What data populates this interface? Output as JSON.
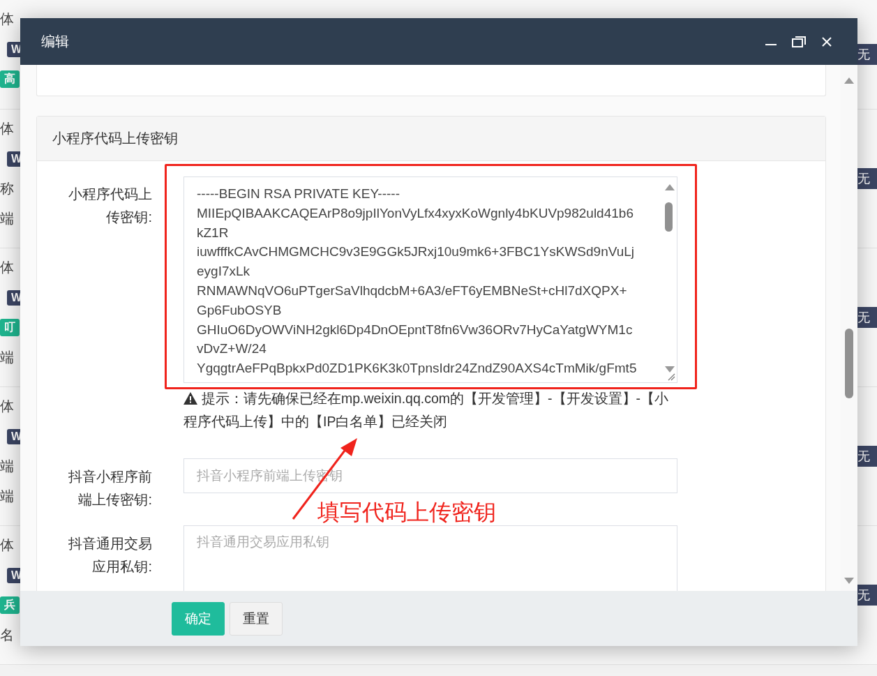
{
  "background_rows": [
    {
      "items": [
        {
          "kind": "text",
          "text": "体"
        },
        {
          "kind": "badge",
          "text": "W",
          "color": "#3b4563"
        },
        {
          "kind": "badge",
          "text": "高",
          "color": "#1fb58f"
        }
      ],
      "tag": "无"
    },
    {
      "items": [
        {
          "kind": "text",
          "text": "体"
        },
        {
          "kind": "badge",
          "text": "W",
          "color": "#3b4563"
        },
        {
          "kind": "text",
          "text": "称"
        },
        {
          "kind": "text",
          "text": "端"
        }
      ],
      "tag": "无"
    },
    {
      "items": [
        {
          "kind": "text",
          "text": "体"
        },
        {
          "kind": "badge",
          "text": "W",
          "color": "#3b4563"
        },
        {
          "kind": "badge",
          "text": "叮",
          "color": "#1fb58f"
        },
        {
          "kind": "text",
          "text": "端"
        }
      ],
      "tag": "无"
    },
    {
      "items": [
        {
          "kind": "text",
          "text": "体"
        },
        {
          "kind": "badge",
          "text": "W",
          "color": "#3b4563"
        },
        {
          "kind": "text",
          "text": "端"
        },
        {
          "kind": "text",
          "text": "端"
        }
      ],
      "tag": "无"
    },
    {
      "items": [
        {
          "kind": "text",
          "text": "体"
        },
        {
          "kind": "badge",
          "text": "W",
          "color": "#3b4563"
        },
        {
          "kind": "badge",
          "text": "兵",
          "color": "#1fb58f"
        },
        {
          "kind": "text",
          "text": "名"
        }
      ],
      "tag": "无"
    }
  ],
  "dialog": {
    "title": "编辑",
    "section": {
      "title": "小程序代码上传密钥",
      "fields": [
        {
          "kind": "textarea",
          "label": "小程序代码上传密钥:",
          "value_lines": [
            "-----BEGIN RSA PRIVATE KEY-----",
            "MIIEpQIBAAKCAQEArP8o9jpIlYonVyLfx4xyxKoWgnly4bKUVp982uld41b6",
            "kZ1R",
            "iuwfffkCAvCHMGMCHC9v3E9GGk5JRxj10u9mk6+3FBC1YsKWSd9nVuLj",
            "eygI7xLk",
            "RNMAWNqVO6uPTgerSaVlhqdcbM+6A3/eFT6yEMBNeSt+cHl7dXQPX+",
            "Gp6FubOSYB",
            "GHIuO6DyOWViNH2gkl6Dp4DnOEpntT8fn6Vw36ORv7HyCaYatgWYM1c",
            "vDvZ+W/24",
            "YgqgtrAeFPqBpkxPd0ZD1PK6K3k0TpnsIdr24ZndZ90AXS4cTmMik/gFmt5"
          ],
          "hint": "提示：请先确保已经在mp.weixin.qq.com的【开发管理】-【开发设置】-【小程序代码上传】中的【IP白名单】已经关闭"
        },
        {
          "kind": "input",
          "label": "抖音小程序前端上传密钥:",
          "placeholder": "抖音小程序前端上传密钥"
        },
        {
          "kind": "textarea",
          "label": "抖音通用交易应用私钥:",
          "placeholder": "抖音通用交易应用私钥"
        }
      ]
    },
    "buttons": [
      {
        "kind": "primary",
        "label": "确定"
      },
      {
        "kind": "default",
        "label": "重置"
      }
    ]
  },
  "annotation": {
    "text": "填写代码上传密钥"
  }
}
